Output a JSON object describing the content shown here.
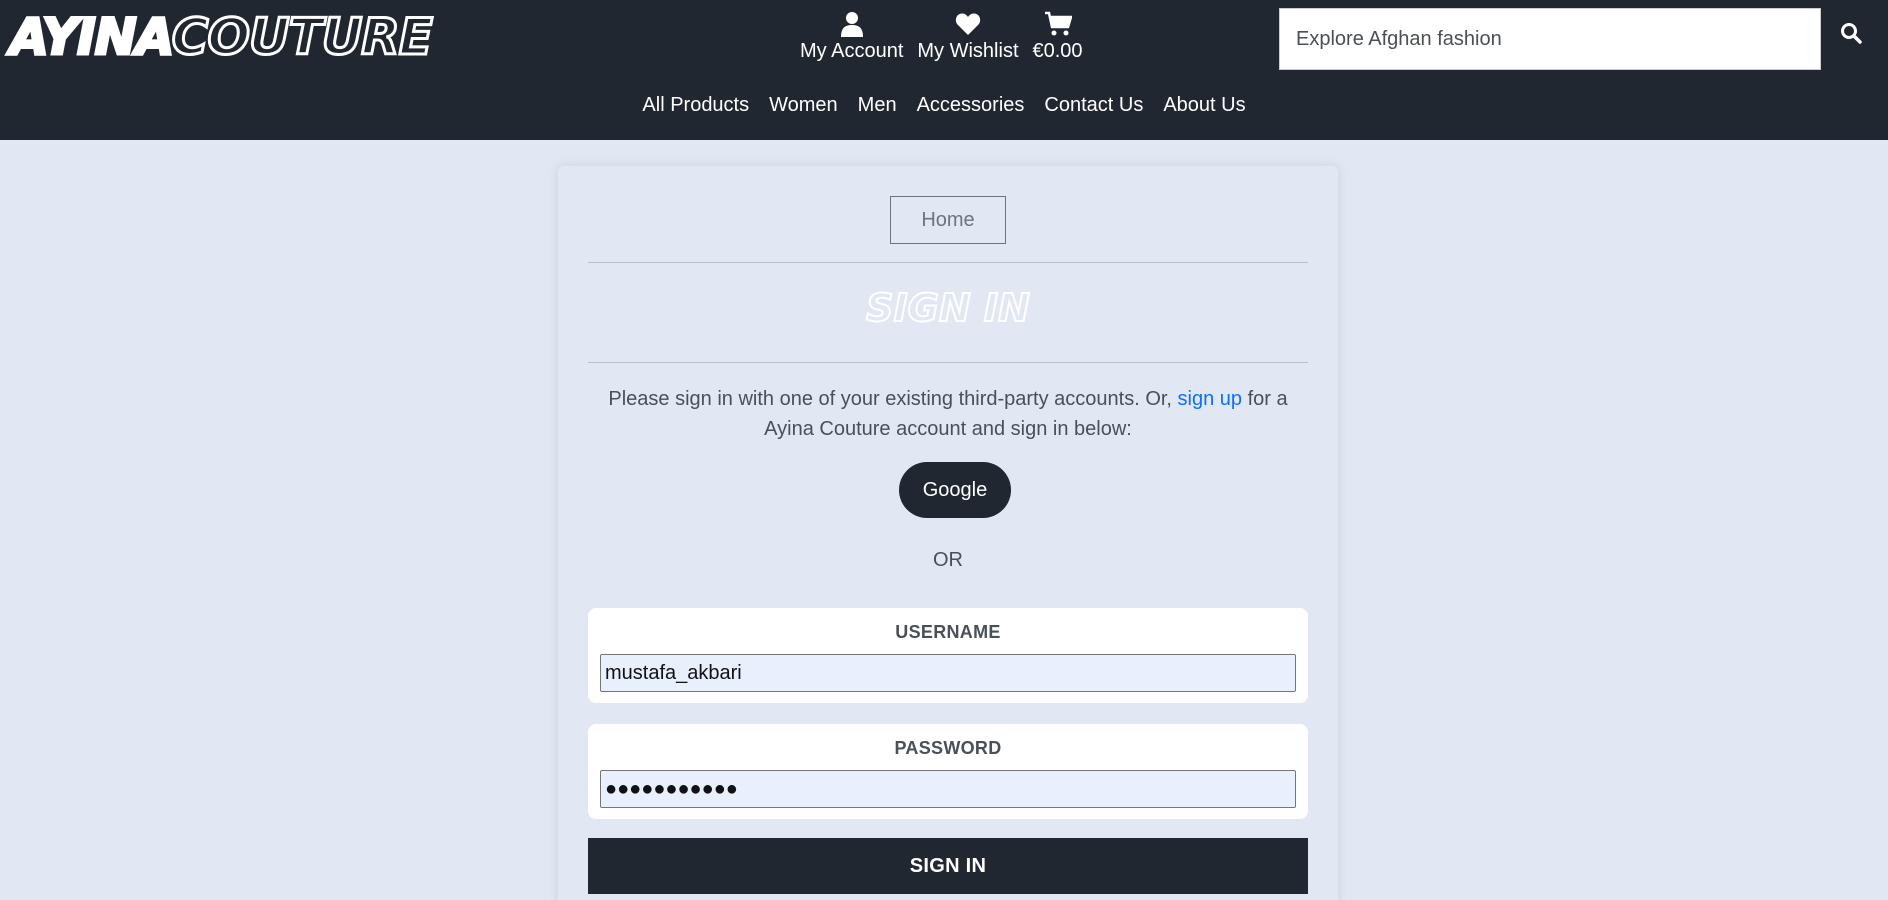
{
  "brand": {
    "logo_text_a": "AYINA",
    "logo_text_b": "COUTURE"
  },
  "header": {
    "account_label": "My Account",
    "wishlist_label": "My Wishlist",
    "cart_total": "€0.00",
    "search_placeholder": "Explore Afghan fashion"
  },
  "nav": {
    "items": [
      {
        "label": "All Products"
      },
      {
        "label": "Women"
      },
      {
        "label": "Men"
      },
      {
        "label": "Accessories"
      },
      {
        "label": "Contact Us"
      },
      {
        "label": "About Us"
      }
    ]
  },
  "signin": {
    "home_button": "Home",
    "title": "SIGN IN",
    "intro_before": "Please sign in with one of your existing third-party accounts. Or, ",
    "signup_link": "sign up",
    "intro_after": " for a Ayina Couture account and sign in below:",
    "google_button": "Google",
    "or_text": "OR",
    "username_label": "USERNAME",
    "username_value": "mustafa_akbari",
    "password_label": "PASSWORD",
    "password_value": "●●●●●●●●●●●",
    "submit_label": "SIGN IN"
  },
  "colors": {
    "header_bg": "#212731",
    "page_bg": "#e1e8f4",
    "link": "#0d6efd",
    "input_bg": "#e8f0fe"
  },
  "icons": {
    "account": "user-icon",
    "wishlist": "heart-icon",
    "cart": "cart-icon",
    "search": "search-icon"
  }
}
